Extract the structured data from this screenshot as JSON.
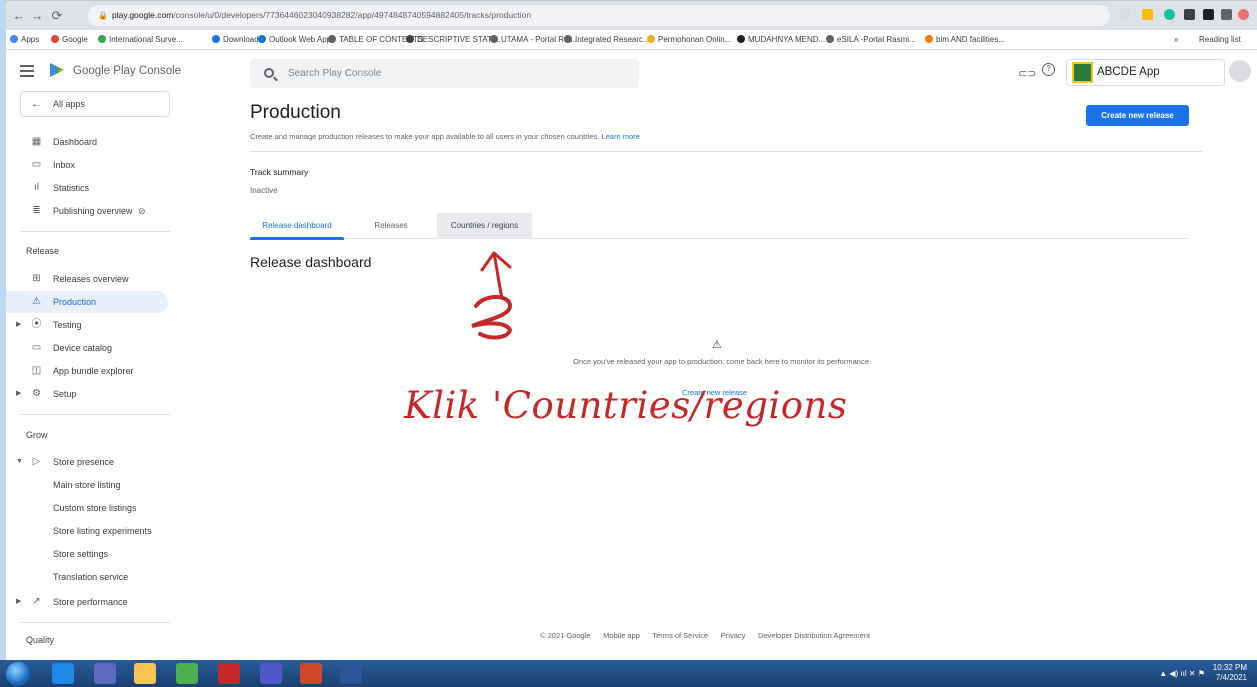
{
  "browser": {
    "url_host": "play.google.com",
    "url_path": "/console/u/0/developers/7736446023040938282/app/4974848740594882405/tracks/production",
    "bookmarks": [
      {
        "label": "Apps",
        "color": "#4285f4"
      },
      {
        "label": "Google",
        "color": "#ea4335"
      },
      {
        "label": "International Surve...",
        "color": "#34a853"
      },
      {
        "label": "Downloads",
        "color": "#1a73e8"
      },
      {
        "label": "Outlook Web App",
        "color": "#0078d4"
      },
      {
        "label": "TABLE OF CONTENTS",
        "color": "#5f6368"
      },
      {
        "label": "DESCRIPTIVE STATI...",
        "color": "#3c4043"
      },
      {
        "label": "UTAMA - Portal Ras...",
        "color": "#5f6368"
      },
      {
        "label": "Integrated Researc...",
        "color": "#5f6368"
      },
      {
        "label": "Permohonan Onlin...",
        "color": "#f9a825"
      },
      {
        "label": "MUDAHNYA MEND...",
        "color": "#202124"
      },
      {
        "label": "eSILA -Portal Rasmi...",
        "color": "#5f6368"
      },
      {
        "label": "bim AND facilities...",
        "color": "#f57c00"
      }
    ],
    "overflow": "»",
    "reading_list": "Reading list"
  },
  "header": {
    "brand_main": "Google Play",
    "brand_sub": "Console",
    "search_placeholder": "Search Play Console",
    "app_name": "ABCDE App"
  },
  "sidebar": {
    "all_apps": "All apps",
    "top_items": [
      {
        "label": "Dashboard",
        "icon": "dashboard-icon"
      },
      {
        "label": "Inbox",
        "icon": "inbox-icon"
      },
      {
        "label": "Statistics",
        "icon": "statistics-icon"
      },
      {
        "label": "Publishing overview",
        "icon": "publishing-overview-icon"
      }
    ],
    "release_label": "Release",
    "release_items": [
      {
        "label": "Releases overview",
        "icon": "releases-overview-icon"
      },
      {
        "label": "Production",
        "icon": "production-icon",
        "active": true
      },
      {
        "label": "Testing",
        "icon": "testing-icon"
      },
      {
        "label": "Device catalog",
        "icon": "device-catalog-icon"
      },
      {
        "label": "App bundle explorer",
        "icon": "app-bundle-icon"
      },
      {
        "label": "Setup",
        "icon": "setup-icon"
      }
    ],
    "grow_label": "Grow",
    "store_presence": "Store presence",
    "store_presence_items": [
      "Main store listing",
      "Custom store listings",
      "Store listing experiments",
      "Store settings",
      "Translation service"
    ],
    "store_performance": "Store performance",
    "quality_label": "Quality"
  },
  "main": {
    "title": "Production",
    "subtitle": "Create and manage production releases to make your app available to all users in your chosen countries.",
    "learn_more": "Learn more",
    "create_button": "Create new release",
    "track_summary_label": "Track summary",
    "track_summary_value": "Inactive",
    "tabs": [
      "Release dashboard",
      "Releases",
      "Countries / regions"
    ],
    "active_tab": "Release dashboard",
    "section_title": "Release dashboard",
    "empty_message": "Once you've released your app to production, come back here to monitor its performance",
    "empty_link": "Create new release"
  },
  "annotation": {
    "number": "2",
    "text": "Klik 'Countries/regions",
    "color": "#c62828"
  },
  "footer": {
    "copyright": "© 2021 Google",
    "links": [
      "Mobile app",
      "Terms of Service",
      "Privacy",
      "Developer Distribution Agreement"
    ]
  },
  "taskbar": {
    "time": "10:32 PM",
    "date": "7/4/2021"
  },
  "colors": {
    "accent": "#1a73e8",
    "active_nav_bg": "#e8f0fe"
  }
}
